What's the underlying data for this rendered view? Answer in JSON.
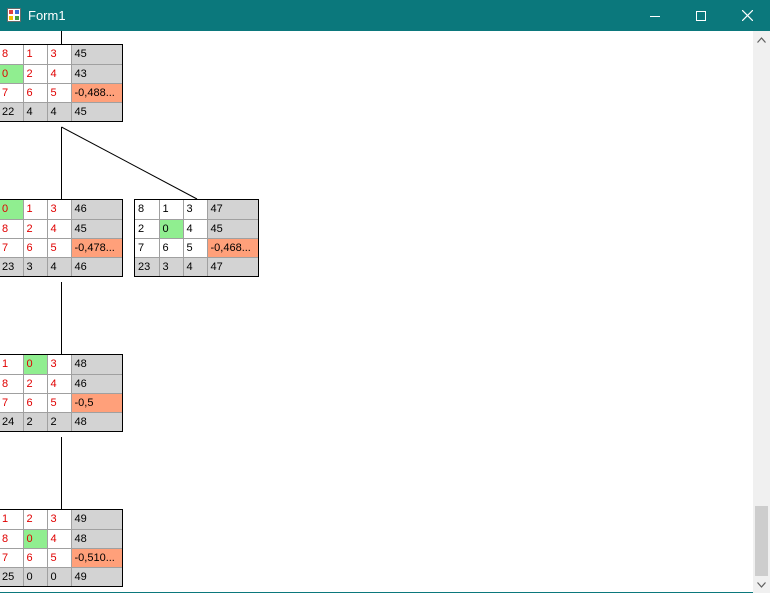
{
  "window": {
    "title": "Form1"
  },
  "colors": {
    "titlebar": "#0b787c",
    "highlight_green": "#90ee90",
    "highlight_orange": "#ffa07a",
    "cell_gray": "#d3d3d3",
    "red_text": "#e00000"
  },
  "icons": {
    "app": "form-icon",
    "minimize": "minimize-icon",
    "maximize": "maximize-icon",
    "close": "close-icon",
    "scroll_up": "arrow-up-icon",
    "scroll_down": "arrow-down-icon"
  },
  "scroll": {
    "position_fraction": 0.85,
    "visible_fraction": 0.13
  },
  "nodes": [
    {
      "rows": [
        [
          "8",
          "1",
          "3",
          "45"
        ],
        [
          "0",
          "2",
          "4",
          "43"
        ],
        [
          "7",
          "6",
          "5",
          "-0,488..."
        ],
        [
          "22",
          "4",
          "4",
          "45"
        ]
      ]
    },
    {
      "rows": [
        [
          "0",
          "1",
          "3",
          "46"
        ],
        [
          "8",
          "2",
          "4",
          "45"
        ],
        [
          "7",
          "6",
          "5",
          "-0,478..."
        ],
        [
          "23",
          "3",
          "4",
          "46"
        ]
      ]
    },
    {
      "rows": [
        [
          "8",
          "1",
          "3",
          "47"
        ],
        [
          "2",
          "0",
          "4",
          "45"
        ],
        [
          "7",
          "6",
          "5",
          "-0,468..."
        ],
        [
          "23",
          "3",
          "4",
          "47"
        ]
      ]
    },
    {
      "rows": [
        [
          "1",
          "0",
          "3",
          "48"
        ],
        [
          "8",
          "2",
          "4",
          "46"
        ],
        [
          "7",
          "6",
          "5",
          "-0,5"
        ],
        [
          "24",
          "2",
          "2",
          "48"
        ]
      ]
    },
    {
      "rows": [
        [
          "1",
          "2",
          "3",
          "49"
        ],
        [
          "8",
          "0",
          "4",
          "48"
        ],
        [
          "7",
          "6",
          "5",
          "-0,510..."
        ],
        [
          "25",
          "0",
          "0",
          "49"
        ]
      ]
    }
  ]
}
